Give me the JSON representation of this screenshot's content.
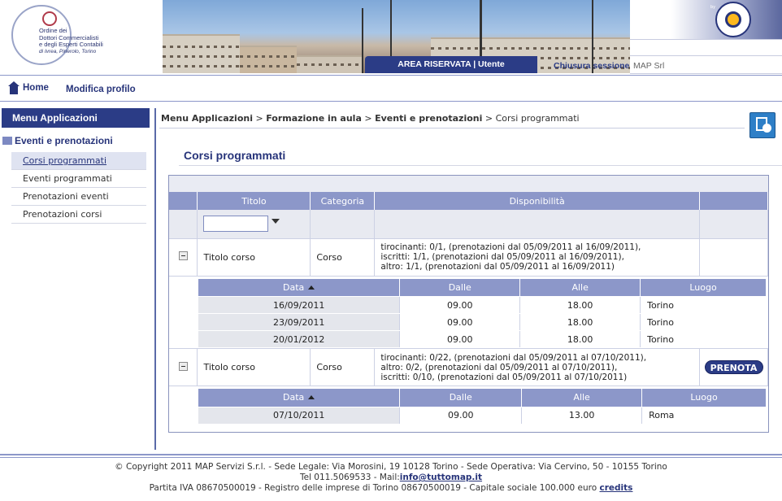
{
  "header": {
    "logo_lines": [
      "Ordine dei",
      "Dottori Commercialisti",
      "e degli Esperti Contabili",
      "di Ivrea, Pinerolo, Torino"
    ],
    "reserved_tab": "AREA RISERVATA | Utente",
    "logout": "Chiusura sessione",
    "user": "MAP Srl",
    "map_by": "by",
    "map_logo": "MAP"
  },
  "nav": {
    "home": "Home",
    "profile": "Modifica profilo"
  },
  "sidebar": {
    "title": "Menu Applicazioni",
    "section": "Eventi e prenotazioni",
    "items": [
      {
        "label": "Corsi programmati",
        "active": true
      },
      {
        "label": "Eventi programmati",
        "active": false
      },
      {
        "label": "Prenotazioni eventi",
        "active": false
      },
      {
        "label": "Prenotazioni corsi",
        "active": false
      }
    ]
  },
  "breadcrumb": {
    "parts": [
      "Menu Applicazioni",
      "Formazione in aula",
      "Eventi e prenotazioni"
    ],
    "sep": " > ",
    "current": "Corsi programmati"
  },
  "page_title": "Corsi programmati",
  "table": {
    "headers": {
      "title": "Titolo",
      "category": "Categoria",
      "availability": "Disponibilità"
    },
    "courses": [
      {
        "title": "Titolo corso",
        "category": "Corso",
        "availability": [
          "tirocinanti: 0/1, (prenotazioni dal 05/09/2011 al 16/09/2011),",
          "iscritti: 1/1, (prenotazioni dal 05/09/2011 al 16/09/2011),",
          "altro: 1/1, (prenotazioni dal 05/09/2011 al 16/09/2011)"
        ],
        "action": "",
        "sessions_headers": {
          "date": "Data",
          "from": "Dalle",
          "to": "Alle",
          "place": "Luogo"
        },
        "sessions": [
          {
            "date": "16/09/2011",
            "from": "09.00",
            "to": "18.00",
            "place": "Torino"
          },
          {
            "date": "23/09/2011",
            "from": "09.00",
            "to": "18.00",
            "place": "Torino"
          },
          {
            "date": "20/01/2012",
            "from": "09.00",
            "to": "18.00",
            "place": "Torino"
          }
        ]
      },
      {
        "title": "Titolo corso",
        "category": "Corso",
        "availability": [
          "tirocinanti: 0/22, (prenotazioni dal 05/09/2011 al 07/10/2011),",
          "altro: 0/2, (prenotazioni dal 05/09/2011 al 07/10/2011),",
          "iscritti: 0/10, (prenotazioni dal 05/09/2011 al 07/10/2011)"
        ],
        "action": "PRENOTA",
        "sessions_headers": {
          "date": "Data",
          "from": "Dalle",
          "to": "Alle",
          "place": "Luogo"
        },
        "sessions": [
          {
            "date": "07/10/2011",
            "from": "09.00",
            "to": "13.00",
            "place": "Roma"
          }
        ]
      }
    ]
  },
  "footer": {
    "line1": "© Copyright 2011 MAP Servizi S.r.l. - Sede Legale: Via Morosini, 19 10128 Torino - Sede Operativa: Via Cervino, 50 - 10155 Torino",
    "line2_prefix": "Tel 011.5069533 - Mail:",
    "email": "info@tuttomap.it",
    "line3_prefix": "Partita IVA 08670500019  - Registro delle imprese di Torino 08670500019 - Capitale sociale 100.000 euro",
    "credits": "credits"
  }
}
